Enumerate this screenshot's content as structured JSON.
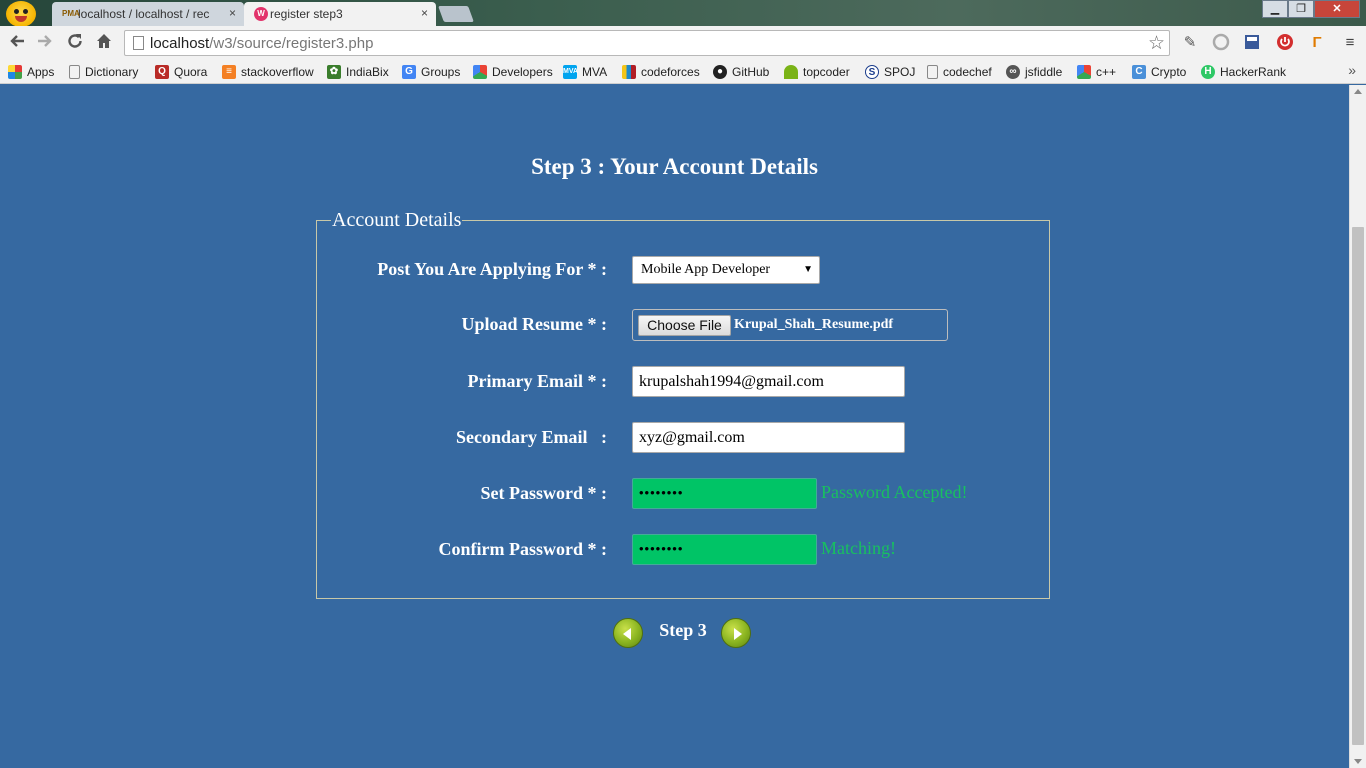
{
  "browser": {
    "tabs": [
      {
        "label": "localhost / localhost / rec",
        "favicon": "PMA"
      },
      {
        "label": "register step3",
        "favicon": "W"
      }
    ],
    "tab_close": "×",
    "window_controls": {
      "minimize": "▁",
      "maximize": "❐",
      "close": "✕"
    },
    "url": {
      "host": "localhost",
      "path": "/w3/source/register3.php"
    },
    "bookmarks": [
      {
        "label": "Apps",
        "icon": "apps-grid-icon",
        "color": "#e53935"
      },
      {
        "label": "Dictionary",
        "icon": "page-icon",
        "color": "#ffffff"
      },
      {
        "label": "Quora",
        "icon": "quora-icon",
        "color": "#b92b27"
      },
      {
        "label": "stackoverflow",
        "icon": "stackoverflow-icon",
        "color": "#f48024"
      },
      {
        "label": "IndiaBix",
        "icon": "indiabix-icon",
        "color": "#3a7d2c"
      },
      {
        "label": "Groups",
        "icon": "groups-icon",
        "color": "#4285f4"
      },
      {
        "label": "Developers",
        "icon": "developers-icon",
        "color": "#34a853"
      },
      {
        "label": "MVA",
        "icon": "mva-icon",
        "color": "#00a4ef"
      },
      {
        "label": "codeforces",
        "icon": "codeforces-icon",
        "color": "#1f8acb"
      },
      {
        "label": "GitHub",
        "icon": "github-icon",
        "color": "#222222"
      },
      {
        "label": "topcoder",
        "icon": "topcoder-icon",
        "color": "#7ab317"
      },
      {
        "label": "SPOJ",
        "icon": "spoj-icon",
        "color": "#1a3c8c"
      },
      {
        "label": "codechef",
        "icon": "page-icon",
        "color": "#ffffff"
      },
      {
        "label": "jsfiddle",
        "icon": "jsfiddle-icon",
        "color": "#555555"
      },
      {
        "label": "c++",
        "icon": "developers-icon",
        "color": "#34a853"
      },
      {
        "label": "Crypto",
        "icon": "crypto-icon",
        "color": "#4a90d9"
      },
      {
        "label": "HackerRank",
        "icon": "hackerrank-icon",
        "color": "#2ec866"
      }
    ],
    "bookmarks_overflow": "»"
  },
  "page": {
    "title": "Step 3 : Your Account Details",
    "legend": "Account Details",
    "fields": {
      "post_label": "Post You Are Applying For * :",
      "post_value": "Mobile App Developer",
      "resume_label": "Upload Resume * :",
      "resume_button": "Choose File",
      "resume_file": "Krupal_Shah_Resume.pdf",
      "primary_email_label": "Primary Email * :",
      "primary_email_value": "krupalshah1994@gmail.com",
      "secondary_email_label": "Secondary Email   :",
      "secondary_email_value": "xyz@gmail.com",
      "password_label": "Set Password * :",
      "password_value": "••••••••",
      "password_status": "Password Accepted!",
      "confirm_label": "Confirm Password * :",
      "confirm_value": "••••••••",
      "confirm_status": "Matching!"
    },
    "step_label": "Step 3"
  },
  "colors": {
    "page_bg": "#3669a1",
    "accepted_green": "#18c060",
    "password_field_bg": "#00c466"
  }
}
